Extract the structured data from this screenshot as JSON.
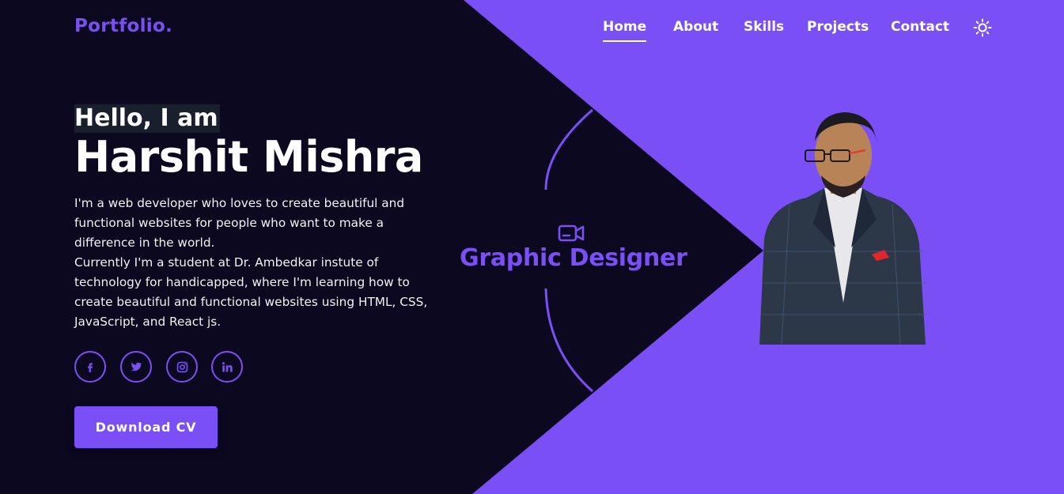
{
  "colors": {
    "background": "#0b0820",
    "accent": "#7a4ff6",
    "text": "#ffffff"
  },
  "header": {
    "logo": "Portfolio.",
    "nav": [
      {
        "label": "Home",
        "active": true
      },
      {
        "label": "About",
        "active": false
      },
      {
        "label": "Skills",
        "active": false
      },
      {
        "label": "Projects",
        "active": false
      },
      {
        "label": "Contact",
        "active": false
      }
    ],
    "theme_toggle_icon": "sun-icon"
  },
  "hero": {
    "greeting": "Hello, I am",
    "name": "Harshit Mishra",
    "bio_1": "I'm a web developer who loves to create beautiful and functional websites for people who want to make a difference in the world.",
    "bio_2": "Currently I'm a student at Dr. Ambedkar instute of technology for handicapped, where I'm learning how to create beautiful and functional websites using HTML, CSS, JavaScript, and React js.",
    "socials": [
      "facebook-icon",
      "twitter-icon",
      "instagram-icon",
      "linkedin-icon"
    ],
    "download_label": "Download CV",
    "role_icon": "video-camera-icon",
    "role": "Graphic Designer"
  }
}
